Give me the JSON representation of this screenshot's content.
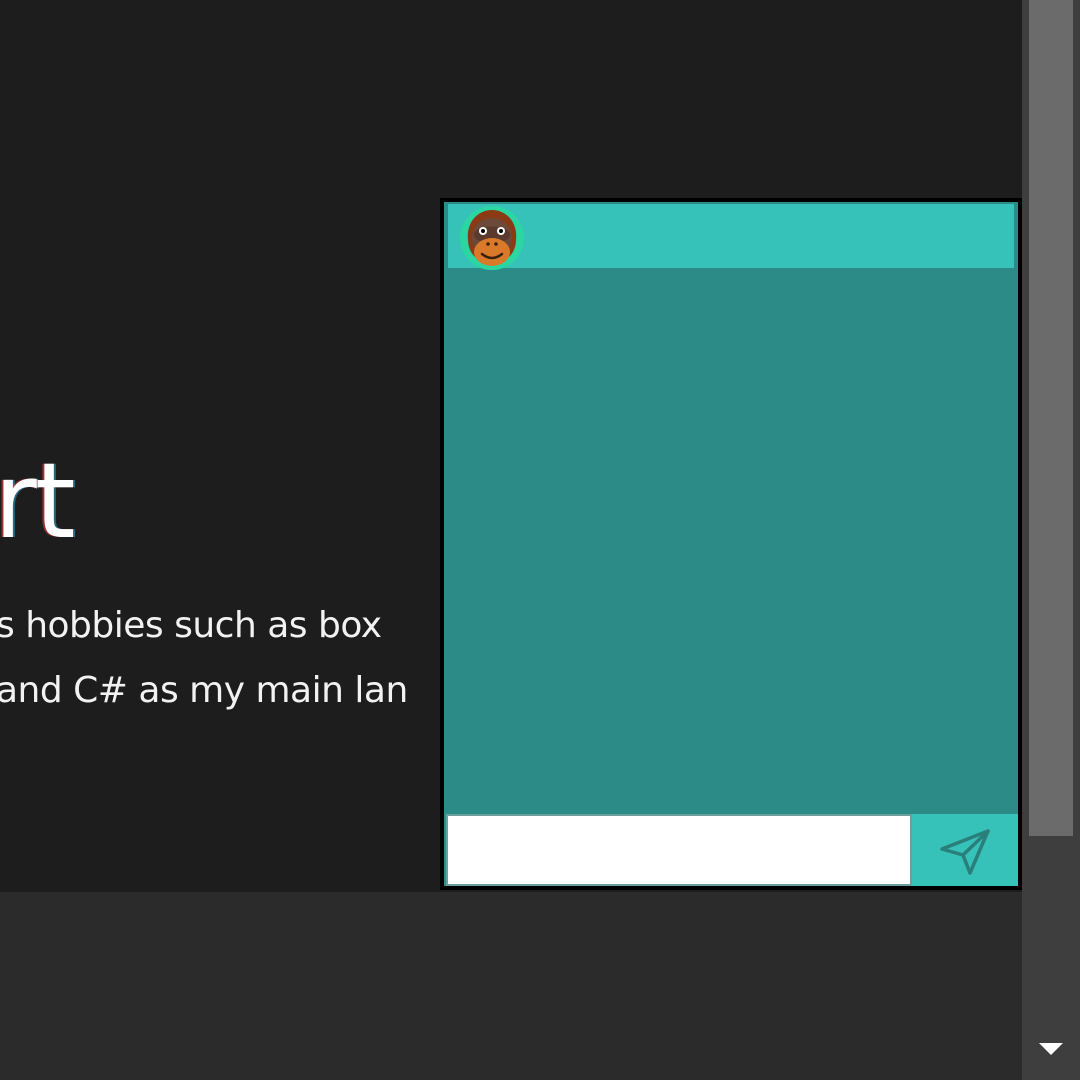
{
  "hero": {
    "title": "rt",
    "line1": "s hobbies such as box",
    "line2": "and C# as my main lan"
  },
  "chat": {
    "avatar_icon": "orangutan-avatar-icon",
    "message_input": {
      "value": "",
      "placeholder": ""
    },
    "send_icon": "paper-plane-icon",
    "colors": {
      "header": "#36c1b9",
      "body": "#2d8b87",
      "border": "#000000",
      "send_button": "#36c1b9"
    }
  },
  "scrollbar": {
    "down_arrow_icon": "scroll-down-arrow-icon"
  },
  "colors": {
    "page_background": "#1d1d1e",
    "footer_band": "#2b2b2b",
    "text": "#ffffff"
  }
}
